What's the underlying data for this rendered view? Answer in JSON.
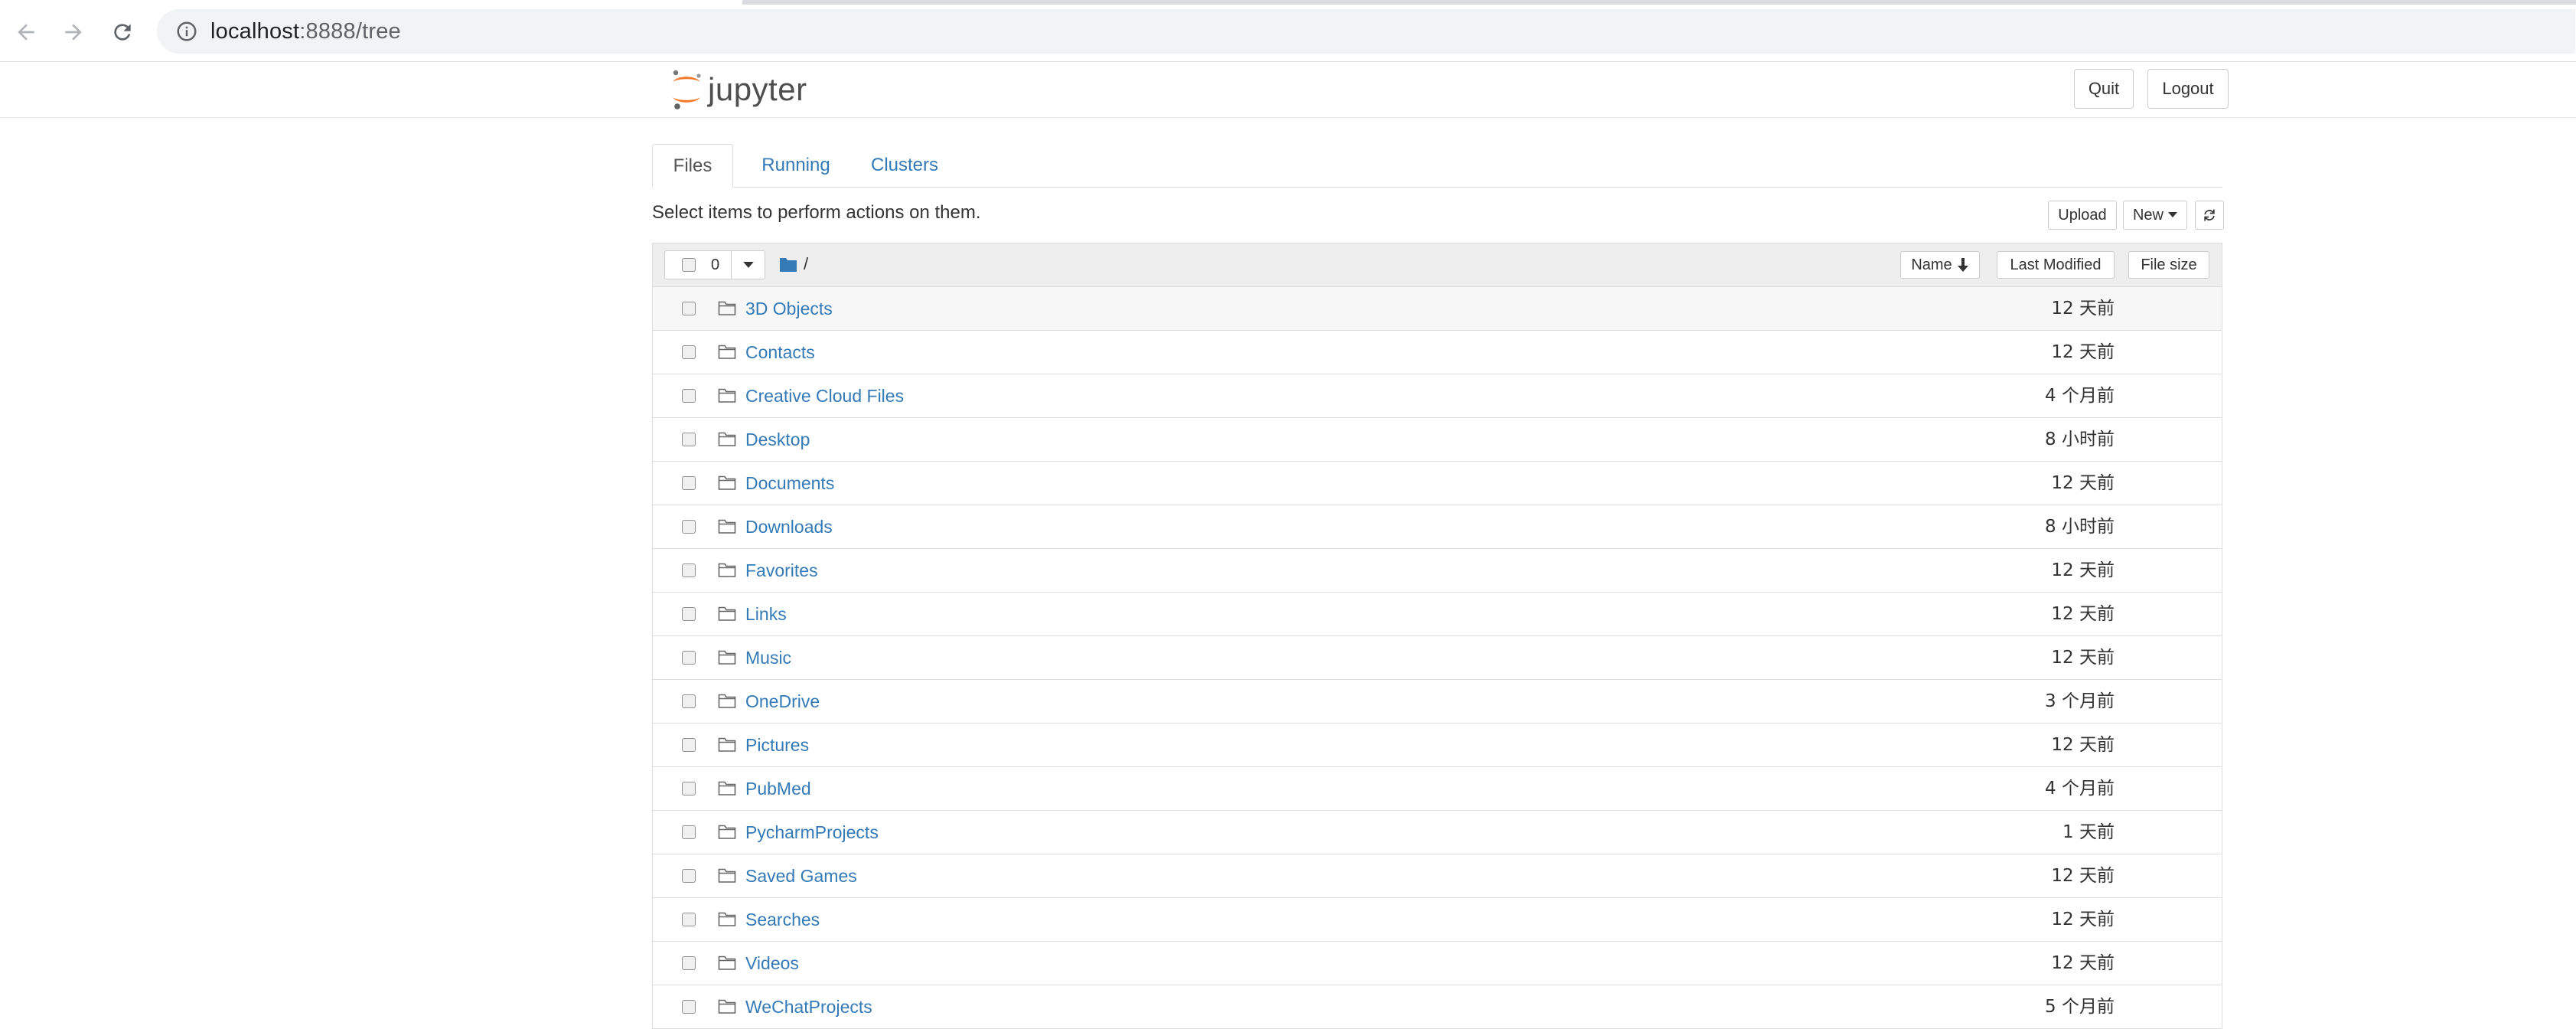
{
  "browser": {
    "url_host": "localhost",
    "url_rest": ":8888/tree",
    "back_icon": "arrow-left-icon",
    "forward_icon": "arrow-right-icon",
    "reload_icon": "reload-icon",
    "info_icon": "info-icon"
  },
  "header": {
    "logo_text": "jupyter",
    "quit_label": "Quit",
    "logout_label": "Logout"
  },
  "tabs": [
    {
      "label": "Files",
      "active": true
    },
    {
      "label": "Running",
      "active": false
    },
    {
      "label": "Clusters",
      "active": false
    }
  ],
  "toolbar": {
    "hint": "Select items to perform actions on them.",
    "upload_label": "Upload",
    "new_label": "New",
    "refresh_icon": "refresh-icon"
  },
  "list_header": {
    "selected_count": "0",
    "breadcrumb": "/",
    "sort_name_label": "Name",
    "sort_modified_label": "Last Modified",
    "sort_size_label": "File size"
  },
  "items": [
    {
      "name": "3D Objects",
      "modified": "12 天前"
    },
    {
      "name": "Contacts",
      "modified": "12 天前"
    },
    {
      "name": "Creative Cloud Files",
      "modified": "4 个月前"
    },
    {
      "name": "Desktop",
      "modified": "8 小时前"
    },
    {
      "name": "Documents",
      "modified": "12 天前"
    },
    {
      "name": "Downloads",
      "modified": "8 小时前"
    },
    {
      "name": "Favorites",
      "modified": "12 天前"
    },
    {
      "name": "Links",
      "modified": "12 天前"
    },
    {
      "name": "Music",
      "modified": "12 天前"
    },
    {
      "name": "OneDrive",
      "modified": "3 个月前"
    },
    {
      "name": "Pictures",
      "modified": "12 天前"
    },
    {
      "name": "PubMed",
      "modified": "4 个月前"
    },
    {
      "name": "PycharmProjects",
      "modified": "1 天前"
    },
    {
      "name": "Saved Games",
      "modified": "12 天前"
    },
    {
      "name": "Searches",
      "modified": "12 天前"
    },
    {
      "name": "Videos",
      "modified": "12 天前"
    },
    {
      "name": "WeChatProjects",
      "modified": "5 个月前"
    }
  ],
  "colors": {
    "link": "#337ab7",
    "logo_orange": "#f37726",
    "border": "#dddddd",
    "header_bg": "#eeeeee"
  }
}
